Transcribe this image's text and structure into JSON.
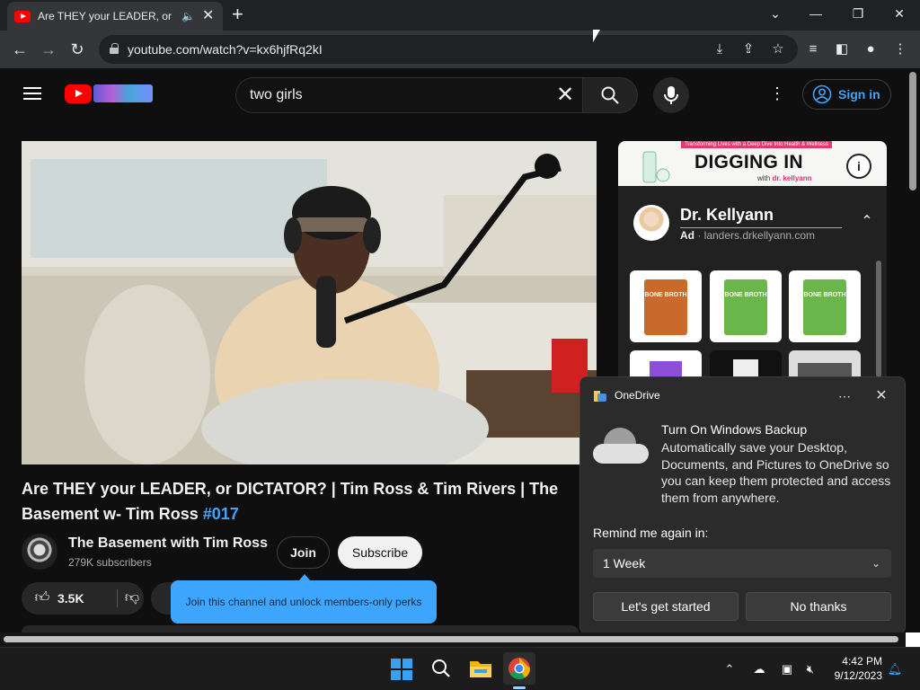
{
  "browser": {
    "tab_title": "Are THEY your LEADER, or DI",
    "url": "youtube.com/watch?v=kx6hjfRq2kI"
  },
  "header": {
    "search_query": "two girls",
    "sign_in_label": "Sign in"
  },
  "video": {
    "title_main": "Are THEY your LEADER, or DICTATOR? | Tim Ross & Tim Rivers | The Basement w- Tim Ross ",
    "title_tag": "#017",
    "channel_name": "The Basement with Tim Ross",
    "subscribers": "279K subscribers",
    "join_label": "Join",
    "subscribe_label": "Subscribe",
    "like_count": "3.5K",
    "join_tooltip": "Join this channel and unlock members-only perks"
  },
  "ad": {
    "banner_tag": "Transforming Lives with a Deep Dive Into Health & Wellness",
    "banner_title": "DIGGING IN",
    "banner_sub_prefix": "with",
    "banner_sub_brand": "dr. kellyann",
    "advertiser": "Dr. Kellyann",
    "ad_label": "Ad",
    "ad_domain": " · landers.drkellyann.com",
    "products": [
      {
        "label": "BONE BROTH",
        "color": "#c96a2b"
      },
      {
        "label": "BONE BROTH",
        "color": "#6bb64a"
      },
      {
        "label": "BONE BROTH",
        "color": "#6bb64a"
      }
    ]
  },
  "onedrive": {
    "app": "OneDrive",
    "title": "Turn On Windows Backup",
    "body": "Automatically save your Desktop, Documents, and Pictures to OneDrive so you can keep them protected and access them from anywhere.",
    "remind_label": "Remind me again in:",
    "remind_value": "1 Week",
    "primary_label": "Let's get started",
    "secondary_label": "No thanks"
  },
  "taskbar": {
    "time": "4:42 PM",
    "date": "9/12/2023"
  },
  "colors": {
    "accent_blue": "#3ea6ff",
    "youtube_red": "#ff0000",
    "page_bg": "#0f0f0f"
  }
}
